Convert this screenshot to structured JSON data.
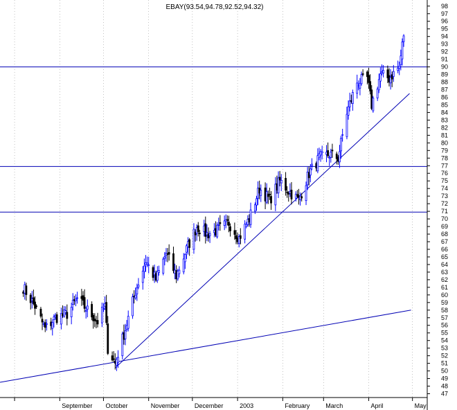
{
  "chart_data": {
    "type": "candlestick",
    "title": "EBAY(93.54,94.78,92.52,94.32)",
    "ylim": [
      46.5,
      98.8
    ],
    "y_ticks": [
      47,
      48,
      49,
      50,
      51,
      52,
      53,
      54,
      55,
      56,
      57,
      58,
      59,
      60,
      61,
      62,
      63,
      64,
      65,
      66,
      67,
      68,
      69,
      70,
      71,
      72,
      73,
      74,
      75,
      76,
      77,
      78,
      79,
      80,
      81,
      82,
      83,
      84,
      85,
      86,
      87,
      88,
      89,
      90,
      91,
      92,
      93,
      94,
      95,
      96,
      97,
      98
    ],
    "x_ticks": [
      "September",
      "October",
      "November",
      "December",
      "2003",
      "February",
      "March",
      "April",
      "May"
    ],
    "grid": "dotted vertical at month starts",
    "horizontal_lines": [
      90.0,
      76.9,
      70.9
    ],
    "trendlines": [
      {
        "from": {
          "date": "2002-07-22",
          "value": 48.5
        },
        "to": {
          "date": "2003-04-30",
          "value": 58.0
        }
      },
      {
        "from": {
          "date": "2002-10-09",
          "value": 50.4
        },
        "to": {
          "date": "2003-04-29",
          "value": 86.5
        }
      }
    ],
    "line_color": "#0000b4",
    "up_color": "#0000ff",
    "down_color": "#000000",
    "anchors": [
      [
        "2002-08-07",
        61.0
      ],
      [
        "2002-08-15",
        58.5
      ],
      [
        "2002-08-22",
        55.5
      ],
      [
        "2002-08-29",
        57.0
      ],
      [
        "2002-09-06",
        57.5
      ],
      [
        "2002-09-13",
        59.5
      ],
      [
        "2002-09-20",
        58.0
      ],
      [
        "2002-09-27",
        56.5
      ],
      [
        "2002-10-02",
        58.5
      ],
      [
        "2002-10-04",
        53.0
      ],
      [
        "2002-10-09",
        51.0
      ],
      [
        "2002-10-16",
        55.5
      ],
      [
        "2002-10-23",
        60.5
      ],
      [
        "2002-10-30",
        64.5
      ],
      [
        "2002-11-06",
        62.0
      ],
      [
        "2002-11-13",
        65.5
      ],
      [
        "2002-11-20",
        62.5
      ],
      [
        "2002-11-27",
        66.0
      ],
      [
        "2002-12-04",
        69.0
      ],
      [
        "2002-12-11",
        68.0
      ],
      [
        "2002-12-18",
        68.5
      ],
      [
        "2002-12-26",
        69.5
      ],
      [
        "2003-01-02",
        67.5
      ],
      [
        "2003-01-09",
        70.0
      ],
      [
        "2003-01-16",
        74.0
      ],
      [
        "2003-01-23",
        72.5
      ],
      [
        "2003-01-30",
        75.0
      ],
      [
        "2003-02-06",
        73.5
      ],
      [
        "2003-02-12",
        72.5
      ],
      [
        "2003-02-19",
        76.0
      ],
      [
        "2003-02-26",
        78.0
      ],
      [
        "2003-03-05",
        78.5
      ],
      [
        "2003-03-11",
        78.0
      ],
      [
        "2003-03-17",
        84.0
      ],
      [
        "2003-03-24",
        88.0
      ],
      [
        "2003-03-31",
        88.5
      ],
      [
        "2003-04-03",
        85.0
      ],
      [
        "2003-04-09",
        89.0
      ],
      [
        "2003-04-15",
        88.5
      ],
      [
        "2003-04-22",
        90.0
      ],
      [
        "2003-04-25",
        94.3
      ]
    ]
  }
}
